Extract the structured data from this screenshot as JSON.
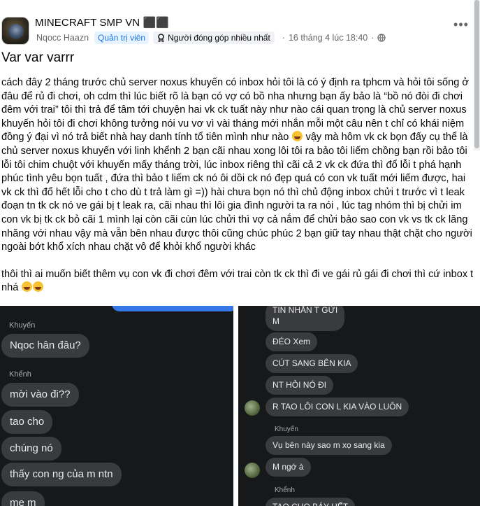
{
  "header": {
    "group_name": "MINECRAFT SMP VN ⬛⬛",
    "author": "Nqocc Haazn",
    "role_badge": "Quản trị viên",
    "contributor_badge": "Người đóng góp nhiều nhất",
    "separator": "·",
    "timestamp": "16 tháng 4 lúc 18:40",
    "more_icon": "more-horizontal-icon",
    "privacy_icon": "globe-icon"
  },
  "post": {
    "title": "Var var varrr",
    "paragraph1_a": "cách đây 2 tháng trước chủ server noxus khuyến có inbox hỏi tôi là có ý định ra tphcm và hỏi tôi sống ở đâu để rủ đi chơi, oh cdm thì lúc biết rõ là bạn có vợ có bồ nha nhưng bạn ấy bảo là “bồ nó đòi đi chơi đêm với trai” tôi thì trả để tâm tới chuyện hai vk ck tuất này như nào cái quan trọng là chủ server noxus khuyến hỏi tôi đi chơi không tưởng nói vu vơ vì vài tháng mới nhắn mỗi một câu nên t chỉ có khái niệm đồng ý đại vì nó trả biết nhà hay danh tính tổ tiên mình như nào",
    "paragraph1_b": " vậy mà hôm vk ck bọn đấy cụ thể là chủ server noxus khuyến với linh khểnh 2 bạn cãi nhau xong lôi tôi ra bảo tôi liếm chồng bạn rồi bảo tôi lỗi tôi chim chuột với khuyến mấy tháng trời, lúc inbox riêng thì cãi cả 2 vk ck đứa thì đổ lỗi t phá hạnh phúc tình yêu bọn tuất , đứa thì bảo t liếm ck nó ôi dồi ck nó đẹp quá có con vk tuất mới liếm được, hai vk ck thì đổ hết lỗi cho t cho dù t trả làm gì =)) hài chưa bọn nó thì chủ động inbox chửi t trước vì t leak đoạn tn tk ck nó ve gái bị t leak ra, cãi nhau thì lôi gia đình người ta ra nói , lúc tag nhóm thì bị chửi im con vk bị tk ck bỏ cãi 1 mình lại còn cãi cùn lúc chửi thì vợ cả nắm để chửi bảo sao con vk vs tk ck lăng nhăng với nhau vậy mà vẫn bên nhau được thôi cũng chúc phúc 2 bạn giữ tay nhau thật chặt cho người ngoài bớt khổ xích nhau chặt vô để khỏi khổ người khác",
    "paragraph2": "thôi thì ai muốn biết thêm vụ con vk đi chơi đêm với trai còn tk ck thì đi ve gái rủ gái đi chơi thì cứ inbox t nhá",
    "emoji_icon": "rolling-laughing-emoji-icon"
  },
  "screenshot_left": {
    "sender1": "Khuyến",
    "msg1": "Nqoc hân đâu?",
    "sender2": "Khểnh",
    "msgs": [
      "mời vào đi??",
      "tao cho",
      "chúng nó",
      "thấy con ng của m ntn",
      "me m"
    ]
  },
  "screenshot_right": {
    "msgs_top": [
      "TIN NHẮN T GỬI\nM",
      "ĐÉO Xem",
      "CÚT SANG BÊN KIA",
      "NT HỎI NÓ ĐI",
      "R TAO LÔI CON L KIA VÀO LUÔN"
    ],
    "sender1": "Khuyến",
    "msgs_mid": [
      "Vụ bên này sao m xọ sang kia",
      "M ngớ à"
    ],
    "sender2": "Khểnh",
    "msg_cut": "TAO CHO BÁY HẾT"
  },
  "colors": {
    "facebook_blue": "#1b74e4",
    "chat_bg": "#17181a",
    "bubble_gray": "#3a3b3e",
    "messenger_blue": "#3578e5"
  }
}
